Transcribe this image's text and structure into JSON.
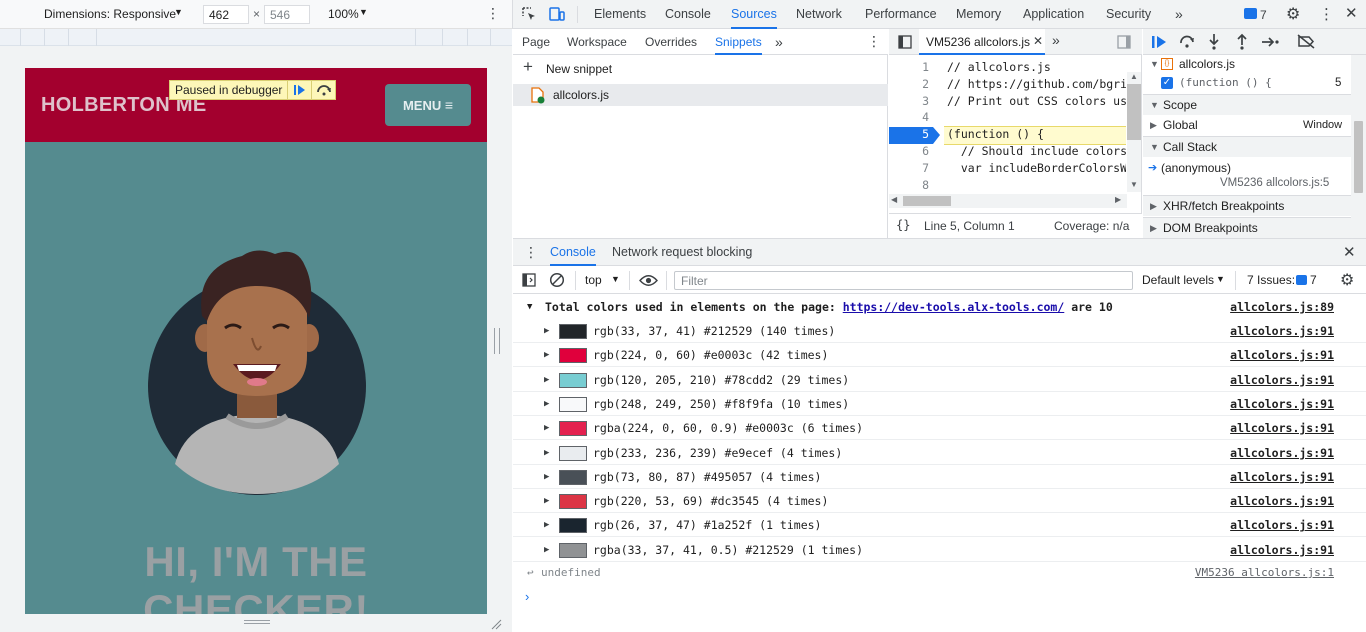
{
  "emulation": {
    "dimensions_label": "Dimensions: Responsive",
    "width": "462",
    "times": "×",
    "height": "546",
    "zoom": "100%"
  },
  "page": {
    "site_title": "HOLBERTON ME",
    "menu_label": "MENU",
    "paused_label": "Paused in debugger",
    "hero_line1": "HI, I'M THE",
    "hero_line2": "CHECKER!"
  },
  "devtools": {
    "tabs": [
      "Elements",
      "Console",
      "Sources",
      "Network",
      "Performance",
      "Memory",
      "Application",
      "Security"
    ],
    "active_tab": "Sources",
    "issues_count": "7"
  },
  "sources": {
    "nav_tabs": [
      "Page",
      "Workspace",
      "Overrides",
      "Snippets"
    ],
    "active_nav_tab": "Snippets",
    "new_snippet_label": "New snippet",
    "snippet_file": "allcolors.js",
    "editor_tab": "VM5236 allcolors.js",
    "code_lines": [
      {
        "n": "1",
        "text": "// allcolors.js",
        "type": "cmt"
      },
      {
        "n": "2",
        "text": "// https://github.com/bgrins",
        "type": "cmt"
      },
      {
        "n": "3",
        "text": "// Print out CSS colors used",
        "type": "cmt"
      },
      {
        "n": "4",
        "text": "",
        "type": "cmt"
      },
      {
        "n": "5",
        "text": "(function () {",
        "type": "code"
      },
      {
        "n": "6",
        "text": "  // Should include colors",
        "type": "cmt"
      },
      {
        "n": "7",
        "text": "  var includeBorderColorsWi",
        "type": "code"
      },
      {
        "n": "8",
        "text": "",
        "type": "code"
      }
    ],
    "status_position": "Line 5, Column 1",
    "status_coverage": "Coverage: n/a"
  },
  "debugger": {
    "breakpoint_file": "allcolors.js",
    "breakpoint_code": "(function () {",
    "breakpoint_line": "5",
    "scope_label": "Scope",
    "global_label": "Global",
    "global_value": "Window",
    "call_stack_label": "Call Stack",
    "frame_name": "(anonymous)",
    "frame_location": "VM5236 allcolors.js:5",
    "xhr_label": "XHR/fetch Breakpoints",
    "dom_label": "DOM Breakpoints"
  },
  "drawer": {
    "tabs": [
      "Console",
      "Network request blocking"
    ],
    "context": "top",
    "filter_placeholder": "Filter",
    "levels": "Default levels",
    "issues_label": "7 Issues:",
    "issues_count": "7"
  },
  "console": {
    "summary_prefix": "Total colors used in elements on the page: ",
    "summary_link": "https://dev-tools.alx-tools.com/",
    "summary_suffix": " are 10",
    "summary_source": "allcolors.js:89",
    "rows": [
      {
        "swatch": "#212529",
        "text": "rgb(33, 37, 41) #212529 (140 times)",
        "source": "allcolors.js:91"
      },
      {
        "swatch": "#e0003c",
        "text": "rgb(224, 0, 60) #e0003c (42 times)",
        "source": "allcolors.js:91"
      },
      {
        "swatch": "#78cdd2",
        "text": "rgb(120, 205, 210) #78cdd2 (29 times)",
        "source": "allcolors.js:91"
      },
      {
        "swatch": "#f8f9fa",
        "text": "rgb(248, 249, 250) #f8f9fa (10 times)",
        "source": "allcolors.js:91"
      },
      {
        "swatch": "#e3214f",
        "text": "rgba(224, 0, 60, 0.9) #e0003c (6 times)",
        "source": "allcolors.js:91"
      },
      {
        "swatch": "#e9ecef",
        "text": "rgb(233, 236, 239) #e9ecef (4 times)",
        "source": "allcolors.js:91"
      },
      {
        "swatch": "#495057",
        "text": "rgb(73, 80, 87) #495057 (4 times)",
        "source": "allcolors.js:91"
      },
      {
        "swatch": "#dc3545",
        "text": "rgb(220, 53, 69) #dc3545 (4 times)",
        "source": "allcolors.js:91"
      },
      {
        "swatch": "#1a252f",
        "text": "rgb(26, 37, 47) #1a252f (1 times)",
        "source": "allcolors.js:91"
      },
      {
        "swatch": "#909294",
        "text": "rgba(33, 37, 41, 0.5) #212529 (1 times)",
        "source": "allcolors.js:91"
      }
    ],
    "result_text": "undefined",
    "result_source": "VM5236 allcolors.js:1"
  }
}
